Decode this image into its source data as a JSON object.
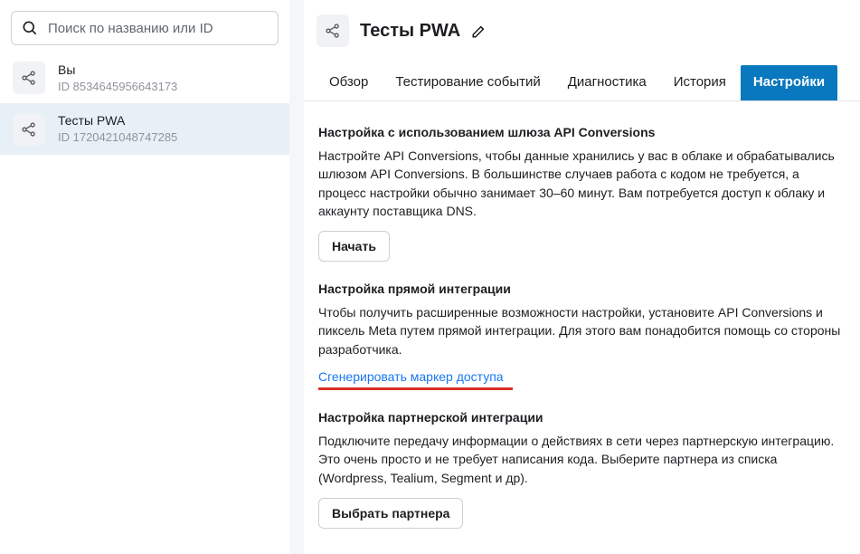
{
  "search": {
    "placeholder": "Поиск по названию или ID"
  },
  "sidebar": {
    "items": [
      {
        "title": "Вы",
        "sub": "ID 8534645956643173"
      },
      {
        "title": "Тесты PWA",
        "sub": "ID 1720421048747285"
      }
    ]
  },
  "header": {
    "title": "Тесты PWA"
  },
  "tabs": [
    {
      "label": "Обзор"
    },
    {
      "label": "Тестирование событий"
    },
    {
      "label": "Диагностика"
    },
    {
      "label": "История"
    },
    {
      "label": "Настройки"
    }
  ],
  "sections": {
    "gateway": {
      "title": "Настройка с использованием шлюза API Conversions",
      "body": "Настройте API Conversions, чтобы данные хранились у вас в облаке и обрабатывались шлюзом API Conversions. В большинстве случаев работа с кодом не требуется, а процесс настройки обычно занимает 30–60 минут. Вам потребуется доступ к облаку и аккаунту поставщика DNS.",
      "button": "Начать"
    },
    "direct": {
      "title": "Настройка прямой интеграции",
      "body": "Чтобы получить расширенные возможности настройки, установите API Conversions и пиксель Meta путем прямой интеграции. Для этого вам понадобится помощь со стороны разработчика.",
      "link": "Сгенерировать маркер доступа"
    },
    "partner": {
      "title": "Настройка партнерской интеграции",
      "body": "Подключите передачу информации о действиях в сети через партнерскую интеграцию. Это очень просто и не требует написания кода. Выберите партнера из списка (Wordpress, Tealium, Segment и др).",
      "button": "Выбрать партнера"
    }
  }
}
